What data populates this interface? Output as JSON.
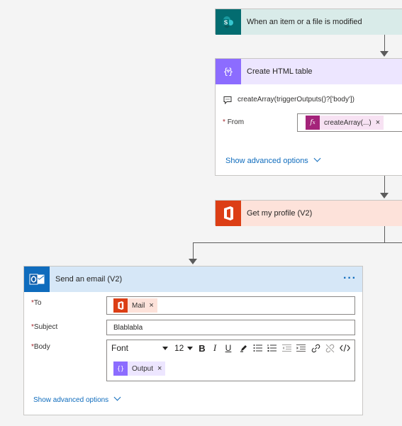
{
  "flow": {
    "trigger": {
      "title": "When an item or a file is modified",
      "icon": "sharepoint-icon",
      "color": "#036c70",
      "header_bg": "#d9ebe9"
    },
    "html_table": {
      "title": "Create HTML table",
      "icon": "data-operations-icon",
      "color": "#8c6cff",
      "header_bg": "#ede6ff",
      "comment": "createArray(triggerOutputs()?['body'])",
      "from_label": "From",
      "from_required": "*",
      "from_token": "createArray(...)",
      "from_token_icon": "fx-icon",
      "remove_glyph": "×",
      "advanced_label": "Show advanced options"
    },
    "profile": {
      "title": "Get my profile (V2)",
      "icon": "office-icon",
      "color": "#dc3e15",
      "header_bg": "#fde2da"
    },
    "email": {
      "title": "Send an email (V2)",
      "icon": "outlook-icon",
      "color": "#0f6cbd",
      "header_bg": "#d6e7f7",
      "more": "···",
      "to_label": "To",
      "subject_label": "Subject",
      "body_label": "Body",
      "required": "*",
      "to_token": "Mail",
      "subject_value": "Blablabla",
      "font_value": "Font",
      "size_value": "12",
      "bold": "B",
      "italic": "I",
      "underline": "U",
      "body_token": "Output",
      "remove_glyph": "×",
      "advanced_label": "Show advanced options"
    }
  }
}
